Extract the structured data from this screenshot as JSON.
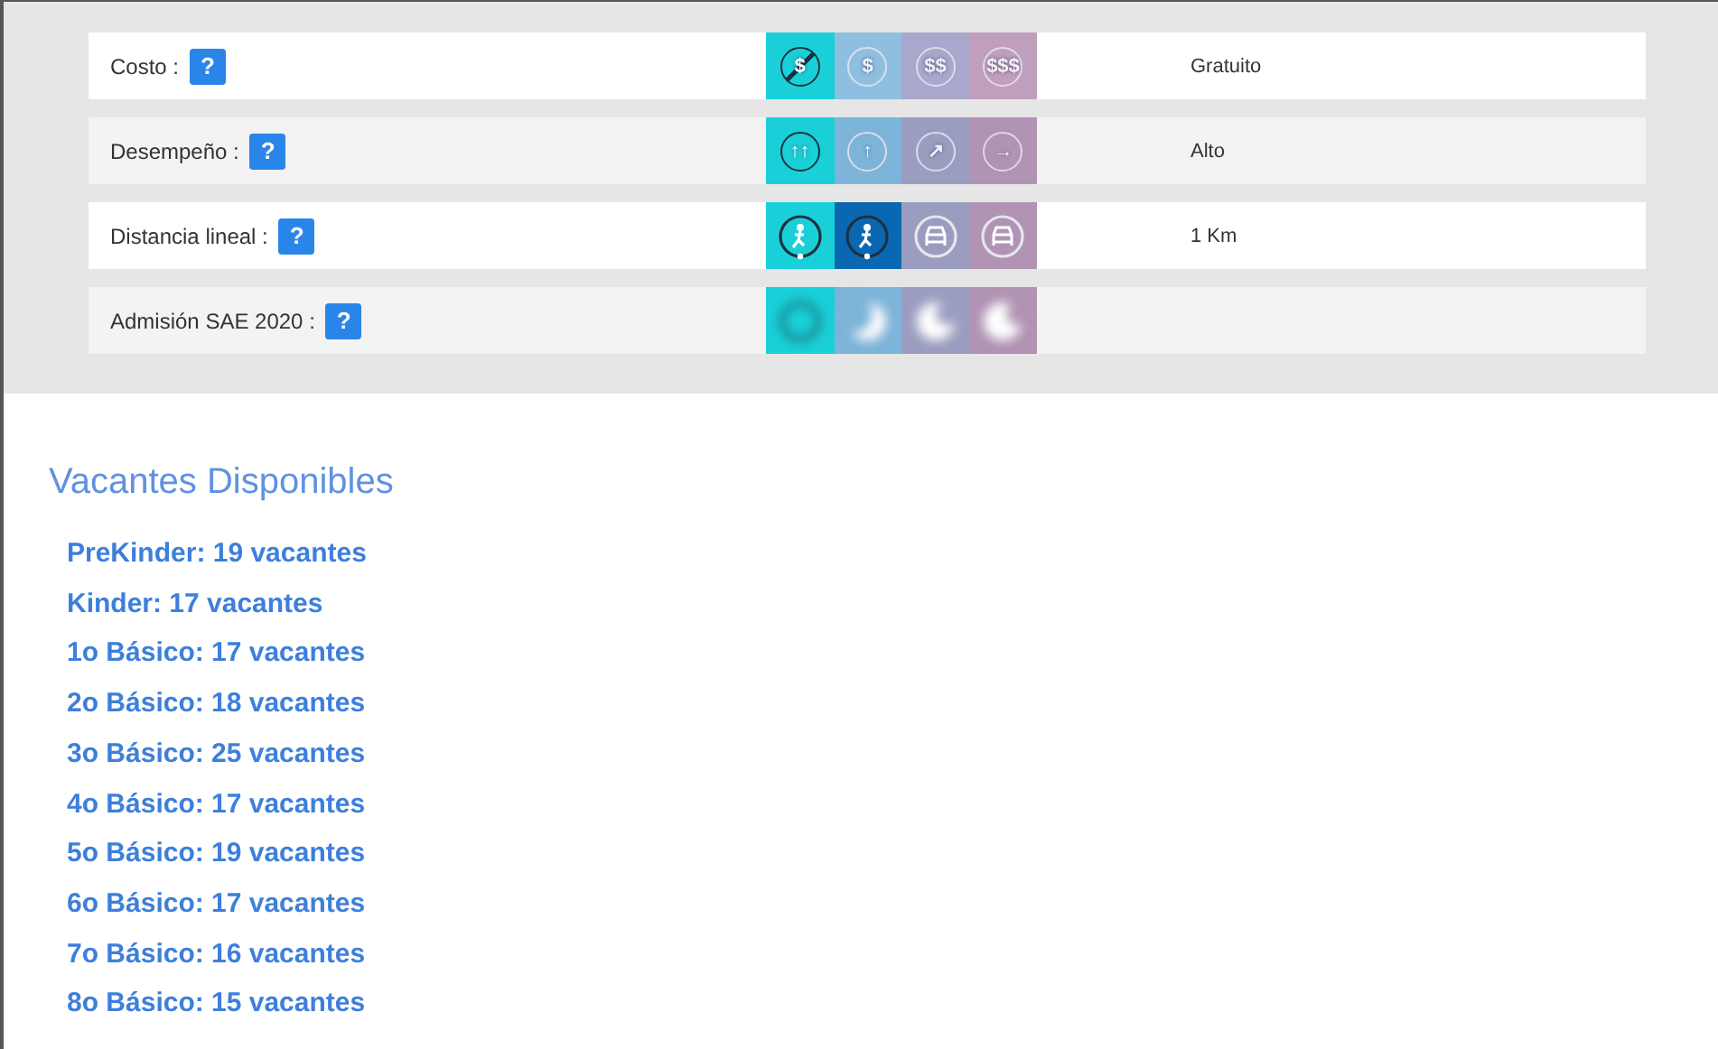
{
  "criteria": [
    {
      "label": "Costo :",
      "help": "?",
      "value": "Gratuito",
      "blurred": false,
      "cells": [
        {
          "kind": "text",
          "symbol": "$",
          "struck": true,
          "selected": true,
          "color": "#19d0d8"
        },
        {
          "kind": "text",
          "symbol": "$",
          "struck": false,
          "selected": false,
          "color": "#8fbfe0"
        },
        {
          "kind": "text",
          "symbol": "$$",
          "struck": false,
          "selected": false,
          "color": "#a9a7cc"
        },
        {
          "kind": "text",
          "symbol": "$$$",
          "struck": false,
          "selected": false,
          "color": "#c09fbd"
        }
      ]
    },
    {
      "label": "Desempeño :",
      "help": "?",
      "value": "Alto",
      "blurred": false,
      "cells": [
        {
          "kind": "text",
          "symbol": "↑↑",
          "struck": false,
          "selected": true,
          "color": "#19d0d8"
        },
        {
          "kind": "text",
          "symbol": "↑",
          "struck": false,
          "selected": false,
          "color": "#7db4d9"
        },
        {
          "kind": "text",
          "symbol": "↗",
          "struck": false,
          "selected": false,
          "color": "#9a9dc0"
        },
        {
          "kind": "text",
          "symbol": "→",
          "struck": false,
          "selected": false,
          "color": "#b193b4"
        }
      ]
    },
    {
      "label": "Distancia lineal :",
      "help": "?",
      "value": "1 Km",
      "blurred": false,
      "cells": [
        {
          "kind": "walk",
          "selected": true,
          "color": "#19d0d8"
        },
        {
          "kind": "walk",
          "selected": true,
          "color": "#0a68b3"
        },
        {
          "kind": "car",
          "selected": false,
          "color": "#9a9dc0"
        },
        {
          "kind": "car",
          "selected": false,
          "color": "#b193b4"
        }
      ]
    },
    {
      "label": "Admisión SAE 2020 :",
      "help": "?",
      "blurred": true,
      "cells": [
        {
          "kind": "phase",
          "selected": true,
          "color": "#19d0d8"
        },
        {
          "kind": "phase",
          "selected": false,
          "color": "#7db4d9"
        },
        {
          "kind": "phase",
          "selected": false,
          "color": "#9a9dc0"
        },
        {
          "kind": "phase",
          "selected": false,
          "color": "#b193b4"
        }
      ]
    }
  ],
  "vacancies": {
    "title": "Vacantes Disponibles",
    "items": [
      "PreKinder: 19 vacantes",
      "Kinder: 17 vacantes",
      "1o Básico: 17 vacantes",
      "2o Básico: 18 vacantes",
      "3o Básico: 25 vacantes",
      "4o Básico: 17 vacantes",
      "5o Básico: 19 vacantes",
      "6o Básico: 17 vacantes",
      "7o Básico: 16 vacantes",
      "8o Básico: 15 vacantes"
    ]
  }
}
